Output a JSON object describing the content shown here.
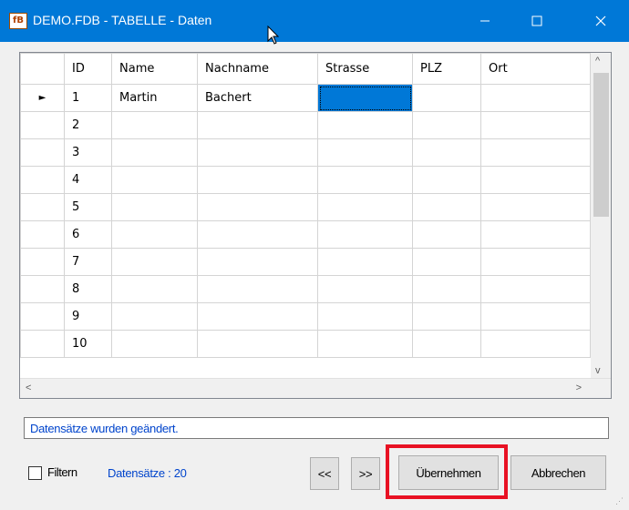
{
  "window": {
    "icon_text": "fB",
    "title": "DEMO.FDB - TABELLE - Daten",
    "controls": {
      "minimize": "—",
      "maximize": "☐",
      "close": "✕"
    }
  },
  "grid": {
    "columns": [
      "ID",
      "Name",
      "Nachname",
      "Strasse",
      "PLZ",
      "Ort"
    ],
    "rows": [
      {
        "id": "1",
        "name": "Martin",
        "nachname": "Bachert"
      },
      {
        "id": "2"
      },
      {
        "id": "3"
      },
      {
        "id": "4"
      },
      {
        "id": "5"
      },
      {
        "id": "6"
      },
      {
        "id": "7"
      },
      {
        "id": "8"
      },
      {
        "id": "9"
      },
      {
        "id": "10"
      }
    ],
    "current_row_marker": "►",
    "scroll": {
      "left": "<",
      "right": ">",
      "up": "^",
      "down": "v"
    }
  },
  "status": {
    "message": "Datensätze wurden geändert."
  },
  "footer": {
    "filter_label": "Filtern",
    "count_label": "Datensätze : 20",
    "prev_label": "<<",
    "next_label": ">>",
    "apply_label": "Übernehmen",
    "cancel_label": "Abbrechen"
  },
  "colors": {
    "titlebar": "#0078d7",
    "highlight": "#e81123",
    "link_blue": "#0044cc"
  }
}
